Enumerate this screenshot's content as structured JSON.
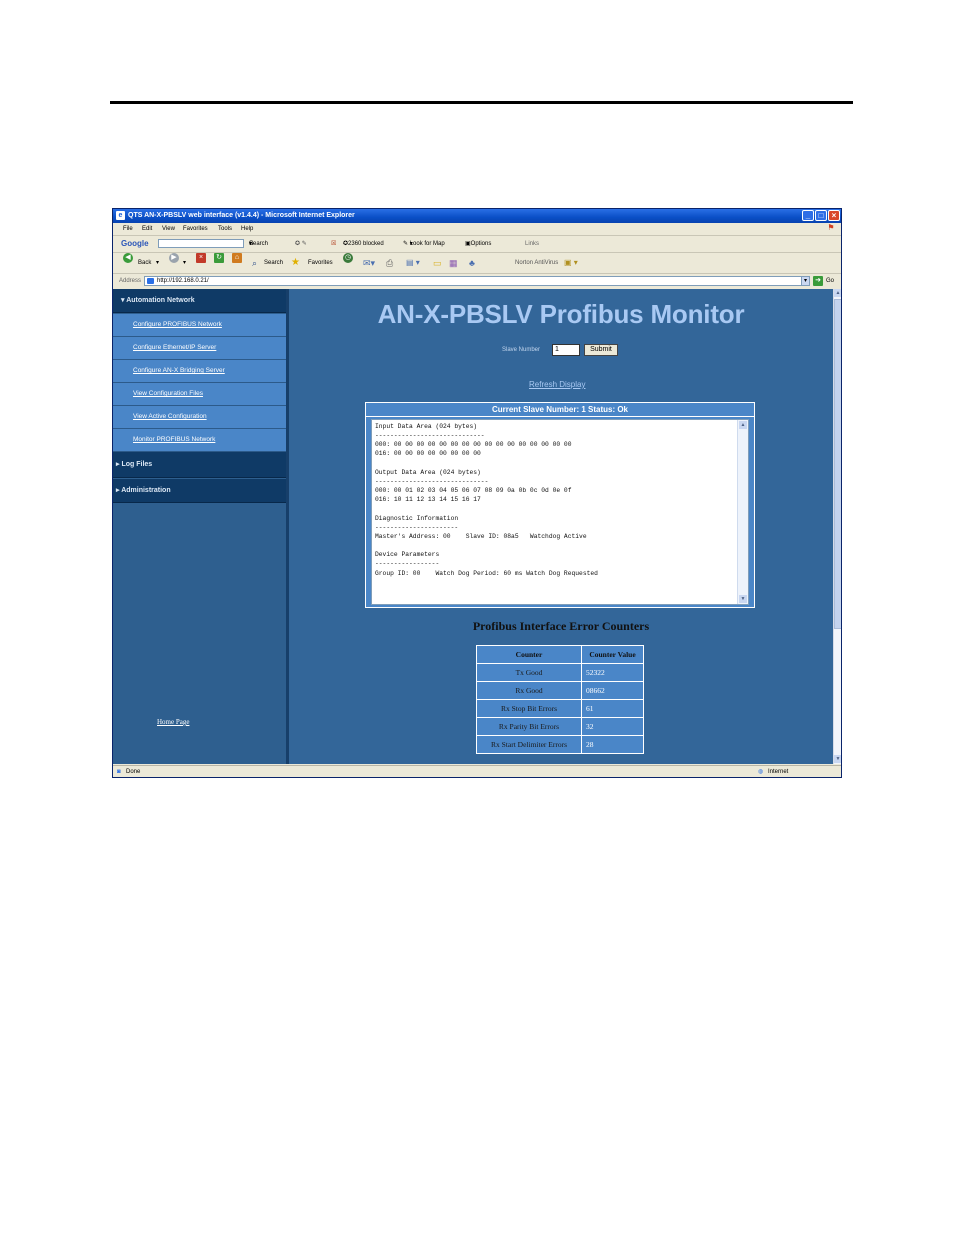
{
  "window": {
    "title": "QTS AN-X-PBSLV web interface (v1.4.4) - Microsoft Internet Explorer",
    "min": "_",
    "max": "□",
    "close": "×"
  },
  "menu": [
    "File",
    "Edit",
    "View",
    "Favorites",
    "Tools",
    "Help"
  ],
  "googlebar": {
    "brand": "Google",
    "search": "Search",
    "blocked": "2360 blocked",
    "lookfor": "Look for Map",
    "options": "Options",
    "links": "Links"
  },
  "navbar": {
    "back": "Back",
    "search": "Search",
    "favorites": "Favorites",
    "norton": "Norton AntiVirus"
  },
  "address": {
    "label": "Address",
    "url": "http://192.168.0.21/",
    "go": "Go"
  },
  "sidebar": {
    "sections": [
      {
        "label": "Automation Network",
        "expanded": true
      },
      {
        "label": "Log Files",
        "expanded": false
      },
      {
        "label": "Administration",
        "expanded": false
      }
    ],
    "items": [
      "Configure PROFIBUS Network",
      "Configure Ethernet/IP Server",
      "Configure AN-X Bridging Server",
      "View Configuration Files",
      "View Active Configuration",
      "Monitor PROFIBUS Network"
    ],
    "home": "Home Page"
  },
  "main": {
    "title": "AN-X-PBSLV Profibus Monitor",
    "slave_label": "Slave Number",
    "slave_value": "1",
    "submit": "Submit",
    "refresh": "Refresh Display",
    "status_header": "Current Slave Number: 1 Status: Ok",
    "status_text": "Input Data Area (024 bytes)\n-----------------------------\n000: 00 00 00 00 00 00 00 00 00 00 00 00 00 00 00 00\n016: 00 00 00 00 00 00 00 00\n\nOutput Data Area (024 bytes)\n------------------------------\n000: 00 01 02 03 04 05 06 07 08 09 0a 0b 0c 0d 0e 0f\n016: 10 11 12 13 14 15 16 17\n\nDiagnostic Information\n----------------------\nMaster's Address: 00    Slave ID: 08a5   Watchdog Active\n\nDevice Parameters\n-----------------\nGroup ID: 00    Watch Dog Period: 60 ms Watch Dog Requested",
    "error_title": "Profibus Interface Error Counters",
    "error_table": {
      "headers": [
        "Counter",
        "Counter Value"
      ],
      "rows": [
        [
          "Tx Good",
          "52322"
        ],
        [
          "Rx Good",
          "08662"
        ],
        [
          "Rx Stop Bit Errors",
          "61"
        ],
        [
          "Rx Parity Bit Errors",
          "32"
        ],
        [
          "Rx Start Delimiter Errors",
          "28"
        ]
      ]
    }
  },
  "statusbar": {
    "left": "Done",
    "zone": "Internet"
  },
  "colors": {
    "page_bg": "#336699",
    "sidebar_header": "#0f3a66",
    "sidebar_item": "#4a86c8",
    "title_text": "#a9c9f3"
  }
}
